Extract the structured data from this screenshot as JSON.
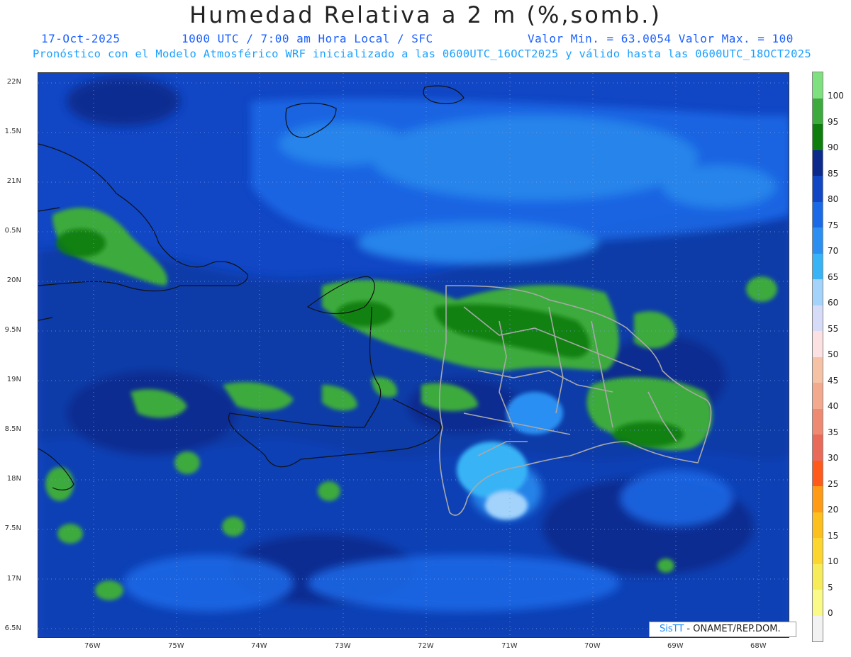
{
  "header": {
    "title": "Humedad Relativa a 2 m (%,somb.)",
    "date": "17-Oct-2025",
    "time": "1000 UTC / 7:00 am Hora Local / SFC",
    "minmax": "Valor Min. = 63.0054  Valor Max. = 100",
    "model": "Pronóstico con el Modelo Atmosférico WRF inicializado a las 0600UTC_16OCT2025 y válido hasta las  0600UTC_18OCT2025"
  },
  "axes": {
    "lat_labels": [
      "22N",
      "1.5N",
      "21N",
      "0.5N",
      "20N",
      "9.5N",
      "19N",
      "8.5N",
      "18N",
      "7.5N",
      "17N",
      "6.5N"
    ],
    "lon_labels": [
      "76W",
      "75W",
      "74W",
      "73W",
      "72W",
      "71W",
      "70W",
      "69W",
      "68W"
    ]
  },
  "colorbar": {
    "labels": [
      "100",
      "95",
      "90",
      "85",
      "80",
      "75",
      "70",
      "65",
      "60",
      "55",
      "50",
      "45",
      "40",
      "35",
      "30",
      "25",
      "20",
      "15",
      "10",
      "5",
      "0"
    ],
    "colors": [
      "#7ee07e",
      "#3daa3d",
      "#0d7d0d",
      "#0b2a8c",
      "#1146c4",
      "#1a6ae8",
      "#2b8ff2",
      "#38b4f6",
      "#a3d3fb",
      "#d6dcf7",
      "#fbe1e1",
      "#f6c2a6",
      "#f2a98e",
      "#ee8a72",
      "#ea6a5a",
      "#ff5a1a",
      "#ff9a14",
      "#fcbf1b",
      "#fcd62e",
      "#f6ec5a",
      "#fafa88",
      "#f2f2f2"
    ]
  },
  "credit": {
    "brand": "SisTT",
    "text": " - ONAMET/REP.DOM."
  }
}
